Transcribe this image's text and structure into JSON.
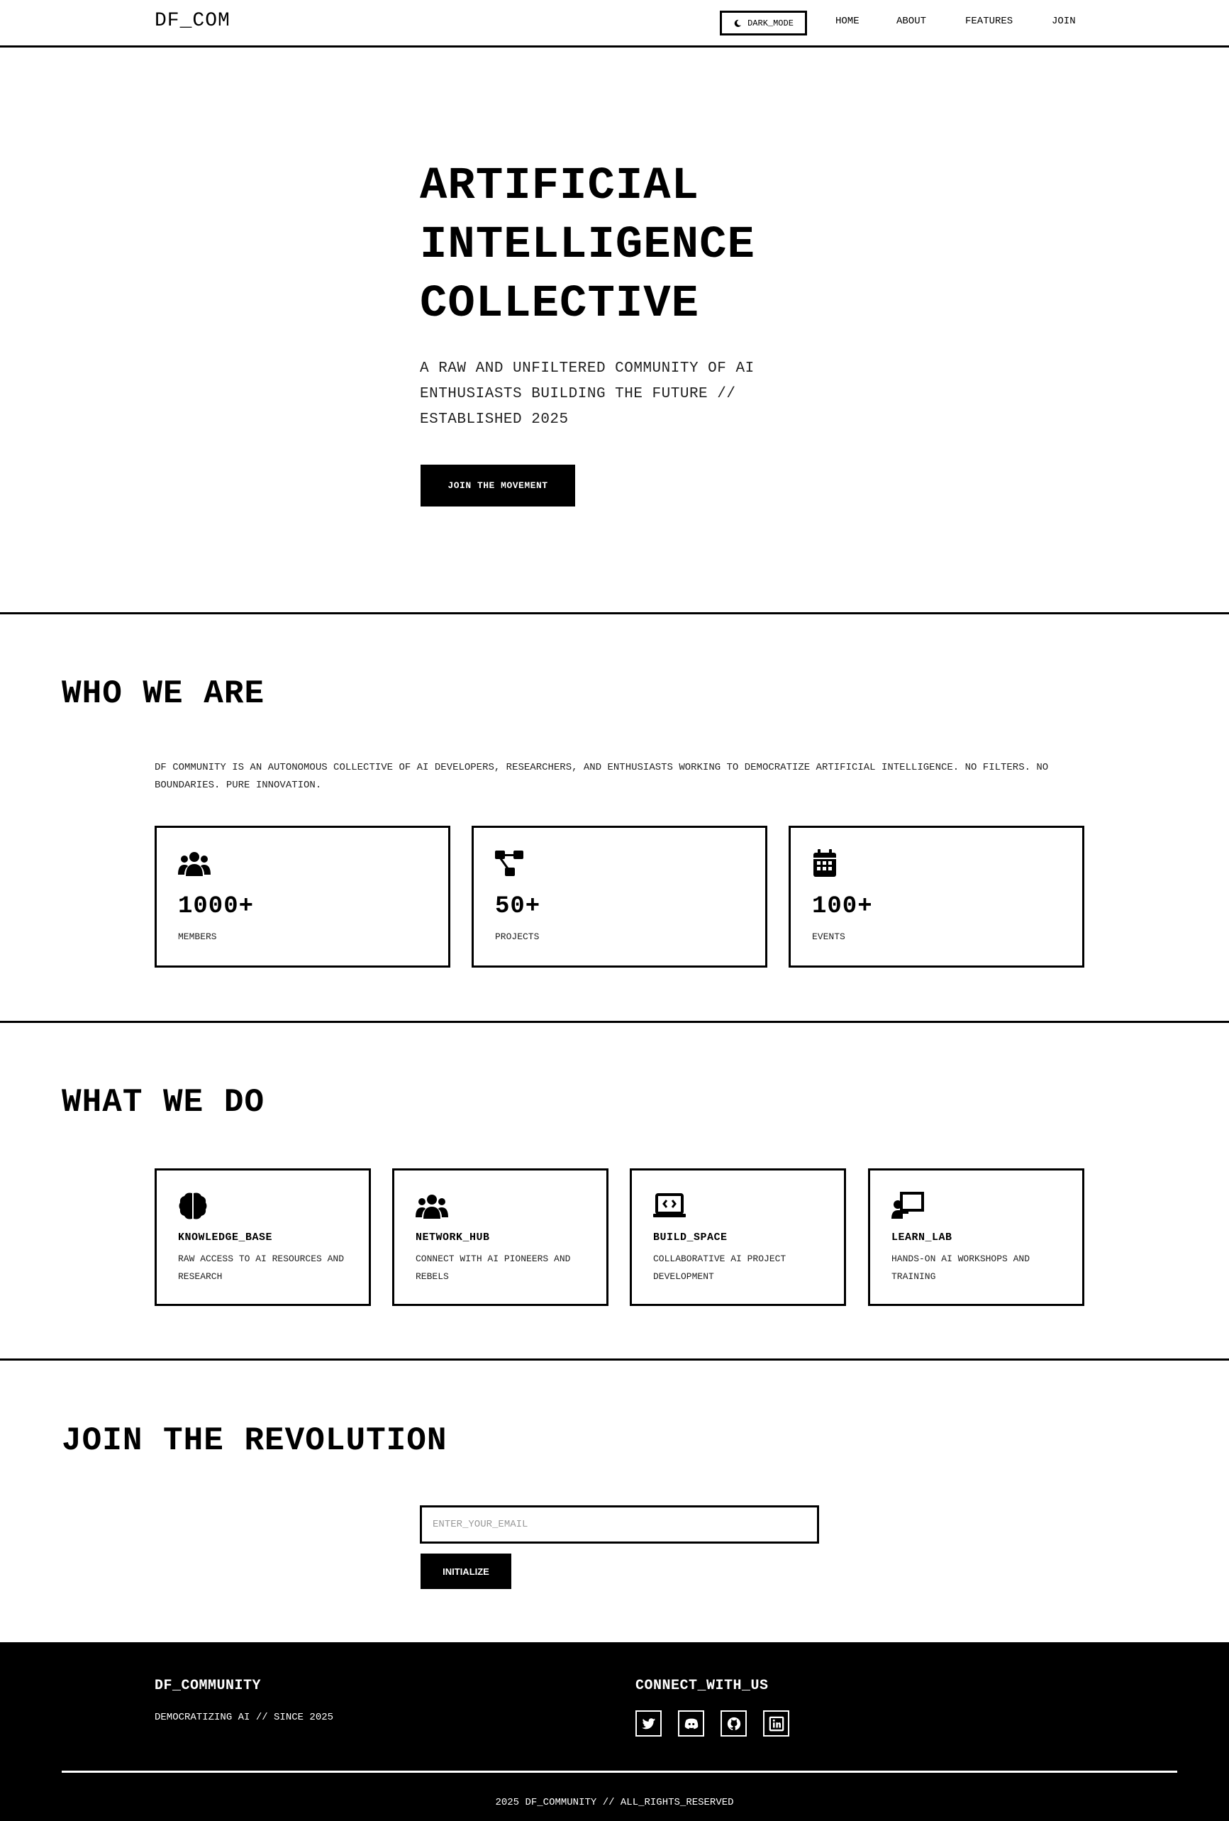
{
  "nav": {
    "logo": "DF_COM",
    "dark_mode_label": "DARK_MODE",
    "links": [
      "HOME",
      "ABOUT",
      "FEATURES",
      "JOIN"
    ]
  },
  "hero": {
    "title_lines": [
      "ARTIFICIAL",
      "INTELLIGENCE",
      "COLLECTIVE"
    ],
    "subtitle": "A RAW AND UNFILTERED COMMUNITY OF AI ENTHUSIASTS BUILDING THE FUTURE // ESTABLISHED 2025",
    "cta_label": "JOIN THE MOVEMENT"
  },
  "about": {
    "title": "WHO WE ARE",
    "text": "DF COMMUNITY IS AN AUTONOMOUS COLLECTIVE OF AI DEVELOPERS, RESEARCHERS, AND ENTHUSIASTS WORKING TO DEMOCRATIZE ARTIFICIAL INTELLIGENCE. NO FILTERS. NO BOUNDARIES. PURE INNOVATION.",
    "stats": [
      {
        "icon": "users-icon",
        "value": "1000+",
        "label": "MEMBERS"
      },
      {
        "icon": "project-diagram-icon",
        "value": "50+",
        "label": "PROJECTS"
      },
      {
        "icon": "calendar-icon",
        "value": "100+",
        "label": "EVENTS"
      }
    ]
  },
  "features": {
    "title": "WHAT WE DO",
    "items": [
      {
        "icon": "brain-icon",
        "title": "KNOWLEDGE_BASE",
        "desc": "RAW ACCESS TO AI RESOURCES AND RESEARCH"
      },
      {
        "icon": "users-icon",
        "title": "NETWORK_HUB",
        "desc": "CONNECT WITH AI PIONEERS AND REBELS"
      },
      {
        "icon": "laptop-code-icon",
        "title": "BUILD_SPACE",
        "desc": "COLLABORATIVE AI PROJECT DEVELOPMENT"
      },
      {
        "icon": "chalkboard-teacher-icon",
        "title": "LEARN_LAB",
        "desc": "HANDS-ON AI WORKSHOPS AND TRAINING"
      }
    ]
  },
  "join": {
    "title": "JOIN THE REVOLUTION",
    "email_placeholder": "ENTER_YOUR_EMAIL",
    "submit_label": "INITIALIZE"
  },
  "footer": {
    "brand": "DF_COMMUNITY",
    "tagline": "DEMOCRATIZING AI // SINCE 2025",
    "connect_title": "CONNECT_WITH_US",
    "socials": [
      "twitter-icon",
      "discord-icon",
      "github-icon",
      "linkedin-icon"
    ],
    "copyright": "2025 DF_COMMUNITY // ALL_RIGHTS_RESERVED"
  }
}
